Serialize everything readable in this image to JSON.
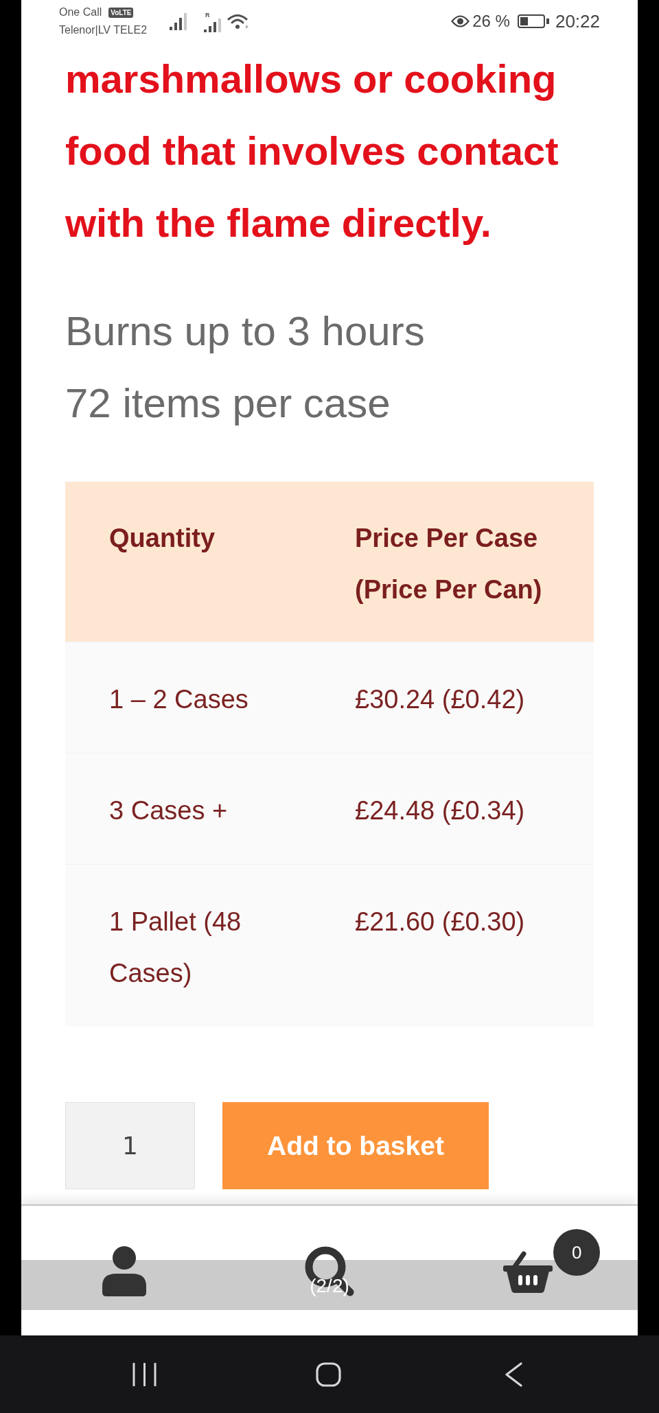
{
  "status_bar": {
    "carrier_top": "One Call",
    "network_badge": "VoLTE",
    "carrier_bottom": "Telenor|LV TELE2",
    "roaming_indicator": "R",
    "battery_percent": "26 %",
    "time": "20:22"
  },
  "product_description": {
    "warning": "marshmallows or cooking food that involves contact with the flame directly.",
    "details": [
      "Burns up to 3 hours",
      "72 items per case"
    ]
  },
  "price_table": {
    "columns": [
      "Quantity",
      "Price Per Case (Price Per Can)"
    ],
    "rows": [
      [
        "1 – 2 Cases",
        "£30.24 (£0.42)"
      ],
      [
        "3 Cases +",
        "£24.48 (£0.34)"
      ],
      [
        "1 Pallet (48 Cases)",
        "£21.60 (£0.30)"
      ]
    ]
  },
  "add_to_basket": {
    "quantity": "1",
    "button": "Add to basket"
  },
  "bottom_bar": {
    "basket_count": "0"
  },
  "overlay": {
    "page_counter": "(2/2)"
  }
}
